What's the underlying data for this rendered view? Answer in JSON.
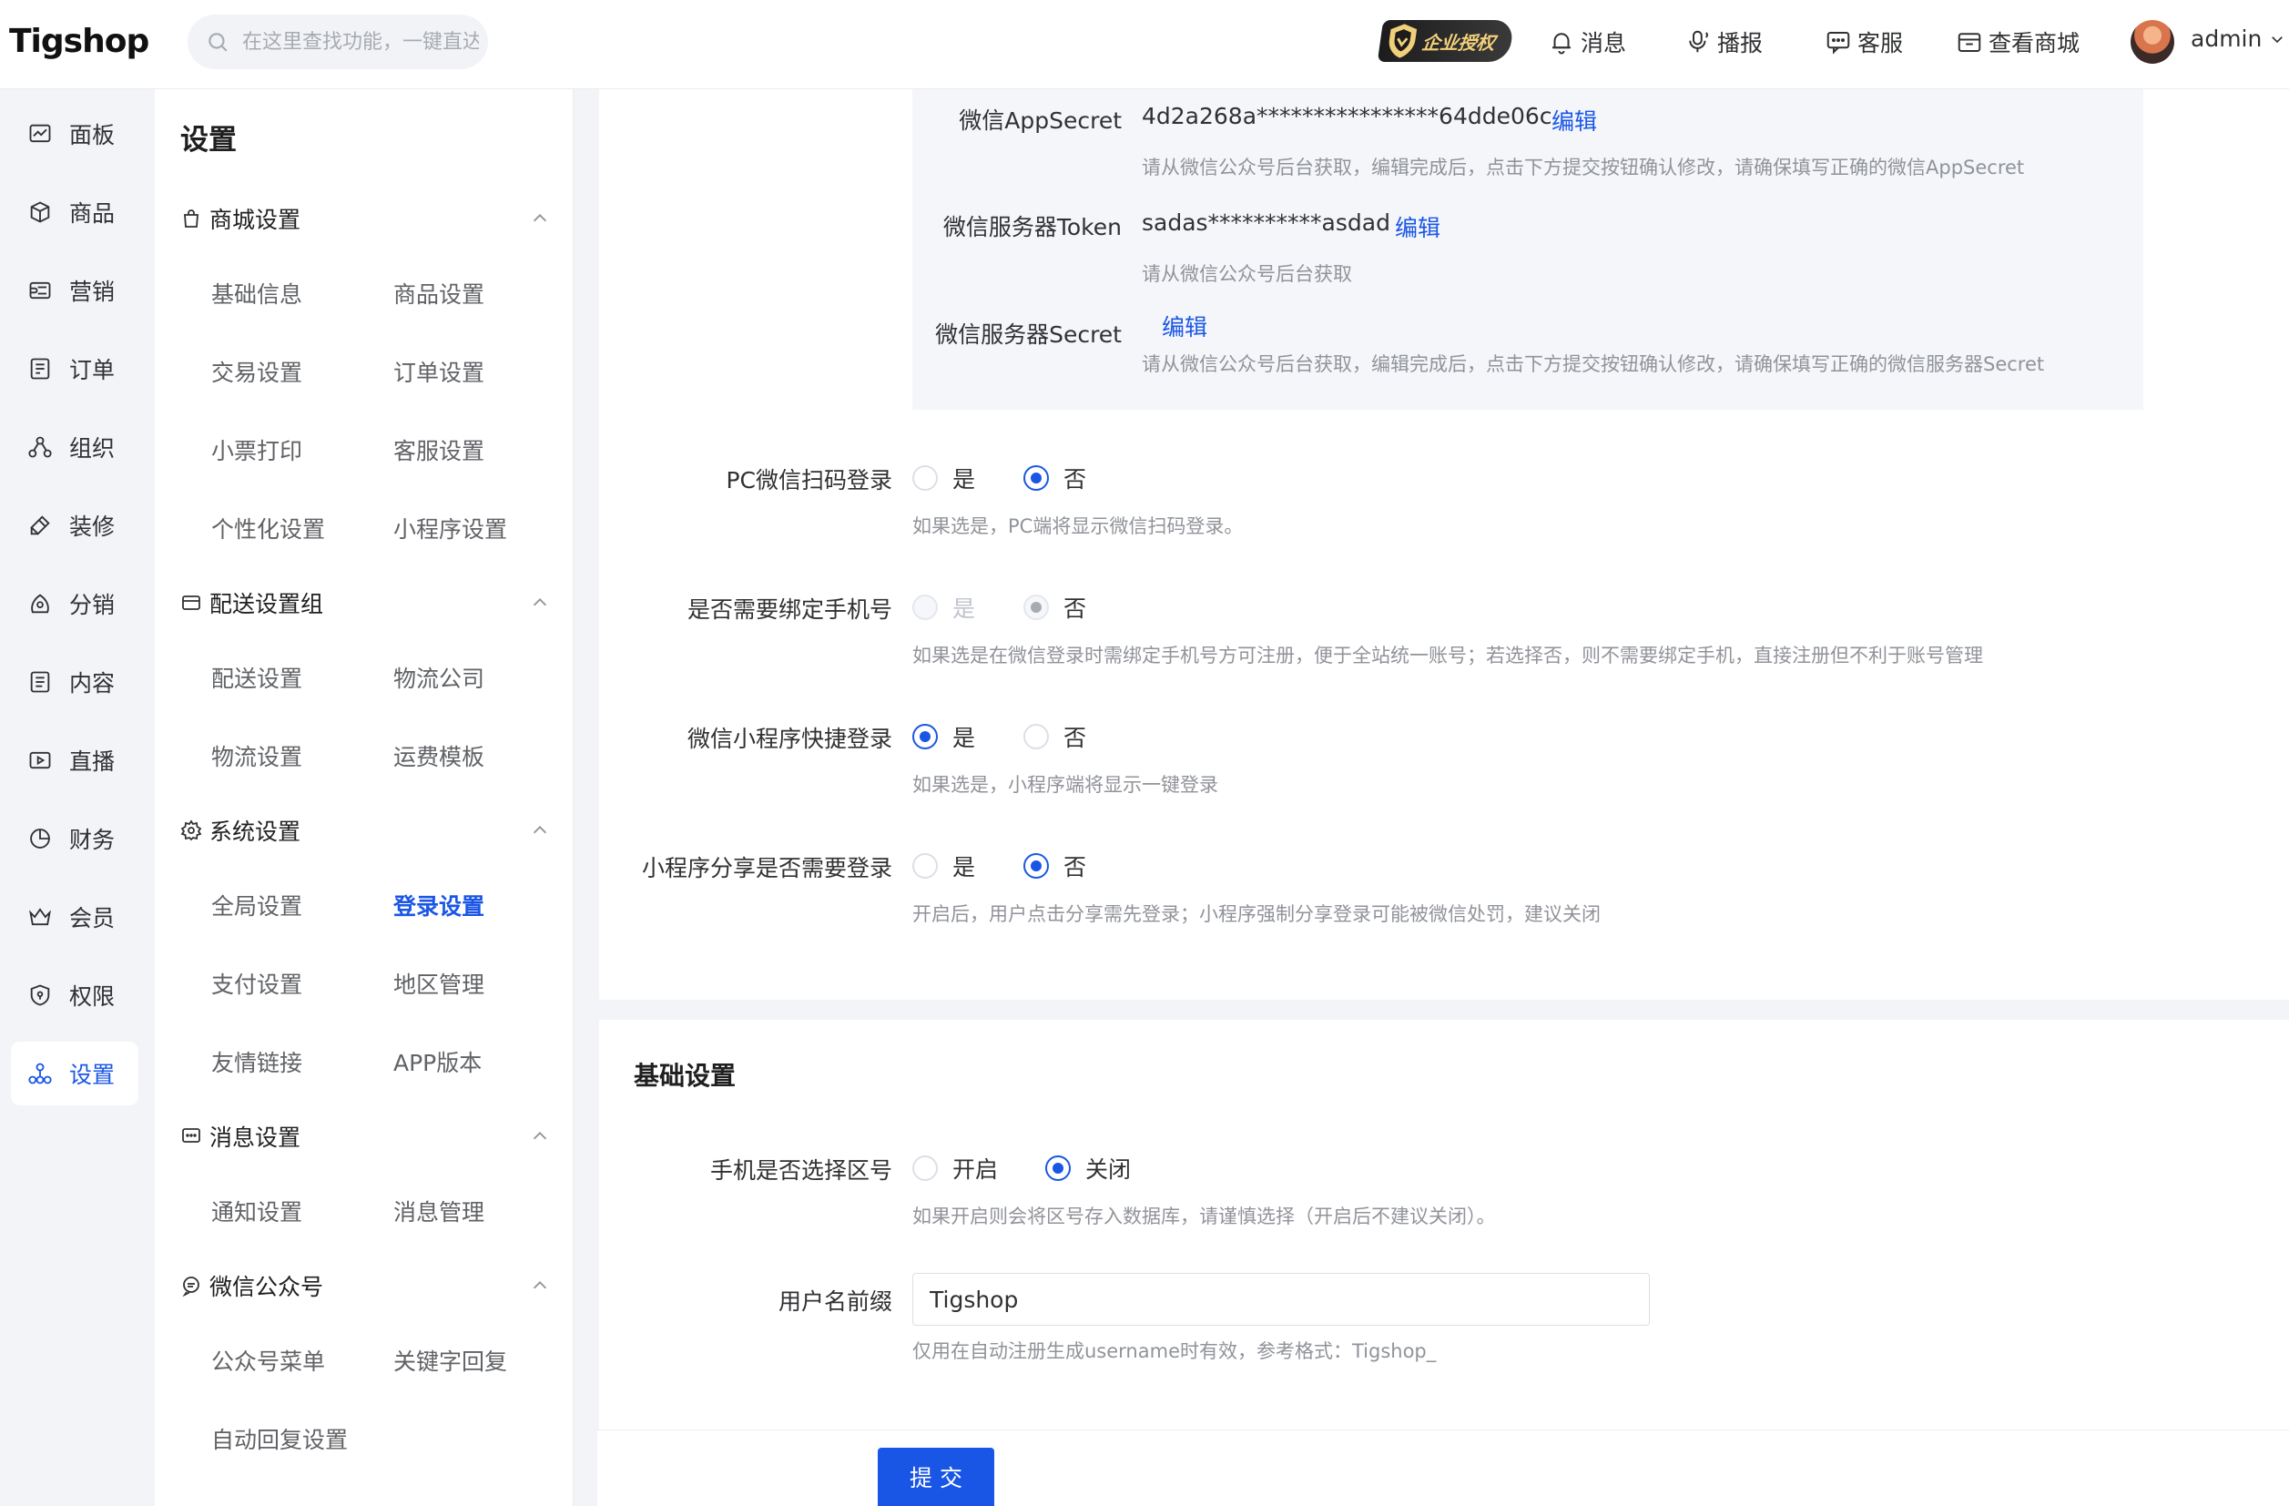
{
  "header": {
    "logo": "Tigshop",
    "search_placeholder": "在这里查找功能，一键直达",
    "auth_badge": "企业授权",
    "links": [
      {
        "label": "消息",
        "icon": "bell-icon"
      },
      {
        "label": "播报",
        "icon": "broadcast-icon"
      },
      {
        "label": "客服",
        "icon": "chat-icon"
      },
      {
        "label": "查看商城",
        "icon": "store-icon"
      }
    ],
    "user": "admin"
  },
  "leftnav": {
    "items": [
      {
        "label": "面板",
        "icon": "dashboard-icon"
      },
      {
        "label": "商品",
        "icon": "box-icon"
      },
      {
        "label": "营销",
        "icon": "marketing-icon"
      },
      {
        "label": "订单",
        "icon": "order-icon"
      },
      {
        "label": "组织",
        "icon": "org-icon"
      },
      {
        "label": "装修",
        "icon": "decorate-icon"
      },
      {
        "label": "分销",
        "icon": "distribution-icon"
      },
      {
        "label": "内容",
        "icon": "content-icon"
      },
      {
        "label": "直播",
        "icon": "live-icon"
      },
      {
        "label": "财务",
        "icon": "finance-icon"
      },
      {
        "label": "会员",
        "icon": "member-icon"
      },
      {
        "label": "权限",
        "icon": "permission-icon"
      },
      {
        "label": "设置",
        "icon": "settings-icon",
        "active": true
      }
    ]
  },
  "submenu": {
    "title": "设置",
    "groups": [
      {
        "label": "商城设置",
        "items": [
          "基础信息",
          "商品设置",
          "交易设置",
          "订单设置",
          "小票打印",
          "客服设置",
          "个性化设置",
          "小程序设置"
        ]
      },
      {
        "label": "配送设置组",
        "items": [
          "配送设置",
          "物流公司",
          "物流设置",
          "运费模板"
        ]
      },
      {
        "label": "系统设置",
        "items": [
          "全局设置",
          "登录设置",
          "支付设置",
          "地区管理",
          "友情链接",
          "APP版本"
        ]
      },
      {
        "label": "消息设置",
        "items": [
          "通知设置",
          "消息管理"
        ]
      },
      {
        "label": "微信公众号",
        "items": [
          "公众号菜单",
          "关键字回复",
          "自动回复设置"
        ]
      }
    ],
    "active_item": "登录设置"
  },
  "wechat": {
    "app_secret_label": "微信AppSecret",
    "app_secret_value": "4d2a268a****************64dde06c",
    "app_secret_edit": "编辑",
    "app_secret_hint": "请从微信公众号后台获取，编辑完成后，点击下方提交按钮确认修改，请确保填写正确的微信AppSecret",
    "token_label": "微信服务器Token",
    "token_value": "sadas**********asdad",
    "token_edit": "编辑",
    "token_hint": "请从微信公众号后台获取",
    "server_secret_label": "微信服务器Secret",
    "server_secret_edit": "编辑",
    "server_secret_hint": "请从微信公众号后台获取，编辑完成后，点击下方提交按钮确认修改，请确保填写正确的微信服务器Secret"
  },
  "login_settings": [
    {
      "label": "PC微信扫码登录",
      "options": [
        "是",
        "否"
      ],
      "selected": "否",
      "hint": "如果选是，PC端将显示微信扫码登录。"
    },
    {
      "label": "是否需要绑定手机号",
      "options": [
        "是",
        "否"
      ],
      "selected": "否",
      "disabled": true,
      "hint": "如果选是在微信登录时需绑定手机号方可注册，便于全站统一账号；若选择否，则不需要绑定手机，直接注册但不利于账号管理"
    },
    {
      "label": "微信小程序快捷登录",
      "options": [
        "是",
        "否"
      ],
      "selected": "是",
      "hint": "如果选是，小程序端将显示一键登录"
    },
    {
      "label": "小程序分享是否需要登录",
      "options": [
        "是",
        "否"
      ],
      "selected": "否",
      "hint": "开启后，用户点击分享需先登录；小程序强制分享登录可能被微信处罚，建议关闭"
    }
  ],
  "basic": {
    "title": "基础设置",
    "area_code_label": "手机是否选择区号",
    "area_code_options": [
      "开启",
      "关闭"
    ],
    "area_code_selected": "关闭",
    "area_code_hint": "如果开启则会将区号存入数据库，请谨慎选择（开启后不建议关闭）。",
    "prefix_label": "用户名前缀",
    "prefix_value": "Tigshop",
    "prefix_hint": "仅用在自动注册生成username时有效，参考格式：Tigshop_"
  },
  "submit_label": "提 交",
  "colors": {
    "primary": "#1a56e6",
    "nav_bg": "#f2f4f7"
  }
}
